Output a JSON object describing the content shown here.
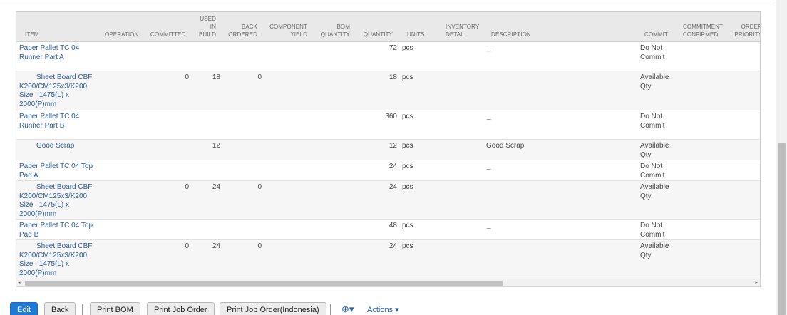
{
  "table": {
    "headers": {
      "item": "ITEM",
      "operation": "OPERATION",
      "committed": "COMMITTED",
      "used_in_build": [
        "USED",
        "IN",
        "BUILD"
      ],
      "back_ordered": [
        "BACK",
        "ORDERED"
      ],
      "component_yield": [
        "COMPONENT",
        "YIELD"
      ],
      "bom_quantity": [
        "BOM",
        "QUANTITY"
      ],
      "quantity": "QUANTITY",
      "units": "UNITS",
      "inventory_detail": [
        "INVENTORY",
        "DETAIL"
      ],
      "description": "DESCRIPTION",
      "commit": "COMMIT",
      "commitment_confirmed": [
        "COMMITMENT",
        "CONFIRMED"
      ],
      "order_priority": [
        "ORDER",
        "PRIORITY"
      ]
    },
    "rows": [
      {
        "item": [
          "Paper Pallet TC 04",
          "Runner Part A"
        ],
        "indent": false,
        "committed": "",
        "used_in_build": "",
        "back_ordered": "",
        "quantity": "72",
        "units": "pcs",
        "description": "_",
        "commit": [
          "Do Not",
          "Commit"
        ]
      },
      {
        "item": [
          "Sheet Board CBF",
          "K200/CM125x3/K200",
          "Size : 1475(L) x",
          "2000(P)mm"
        ],
        "indent": true,
        "committed": "0",
        "used_in_build": "18",
        "back_ordered": "0",
        "quantity": "18",
        "units": "pcs",
        "description": "",
        "commit": [
          "Available",
          "Qty"
        ]
      },
      {
        "item": [
          "Paper Pallet TC 04",
          "Runner Part B"
        ],
        "indent": false,
        "committed": "",
        "used_in_build": "",
        "back_ordered": "",
        "quantity": "360",
        "units": "pcs",
        "description": "_",
        "commit": [
          "Do Not",
          "Commit"
        ]
      },
      {
        "item": [
          "Good Scrap"
        ],
        "indent": true,
        "committed": "",
        "used_in_build": "12",
        "back_ordered": "",
        "quantity": "12",
        "units": "pcs",
        "description": "Good Scrap",
        "commit": [
          "Available",
          "Qty"
        ]
      },
      {
        "item": [
          "Paper Pallet TC 04 Top",
          "Pad A"
        ],
        "indent": false,
        "committed": "",
        "used_in_build": "",
        "back_ordered": "",
        "quantity": "24",
        "units": "pcs",
        "description": "_",
        "commit": [
          "Do Not",
          "Commit"
        ]
      },
      {
        "item": [
          "Sheet Board CBF",
          "K200/CM125x3/K200",
          "Size : 1475(L) x",
          "2000(P)mm"
        ],
        "indent": true,
        "committed": "0",
        "used_in_build": "24",
        "back_ordered": "0",
        "quantity": "24",
        "units": "pcs",
        "description": "",
        "commit": [
          "Available",
          "Qty"
        ]
      },
      {
        "item": [
          "Paper Pallet TC 04 Top",
          "Pad B"
        ],
        "indent": false,
        "committed": "",
        "used_in_build": "",
        "back_ordered": "",
        "quantity": "48",
        "units": "pcs",
        "description": "_",
        "commit": [
          "Do Not",
          "Commit"
        ]
      },
      {
        "item": [
          "Sheet Board CBF",
          "K200/CM125x3/K200",
          "Size : 1475(L) x",
          "2000(P)mm"
        ],
        "indent": true,
        "committed": "0",
        "used_in_build": "24",
        "back_ordered": "0",
        "quantity": "24",
        "units": "pcs",
        "description": "",
        "commit": [
          "Available",
          "Qty"
        ]
      }
    ]
  },
  "scroll": {
    "left_arrow": "◂",
    "right_arrow": "▸"
  },
  "toolbar": {
    "edit": "Edit",
    "back": "Back",
    "print_bom": "Print BOM",
    "print_job_order": "Print Job Order",
    "print_job_order_indonesia": "Print Job Order(Indonesia)",
    "actions": "Actions ▾",
    "add_icon": "⊕▾"
  },
  "colors": {
    "primary": "#1f7ad6",
    "link": "#2b5b9a",
    "header_bg": "#e9e9e9"
  }
}
